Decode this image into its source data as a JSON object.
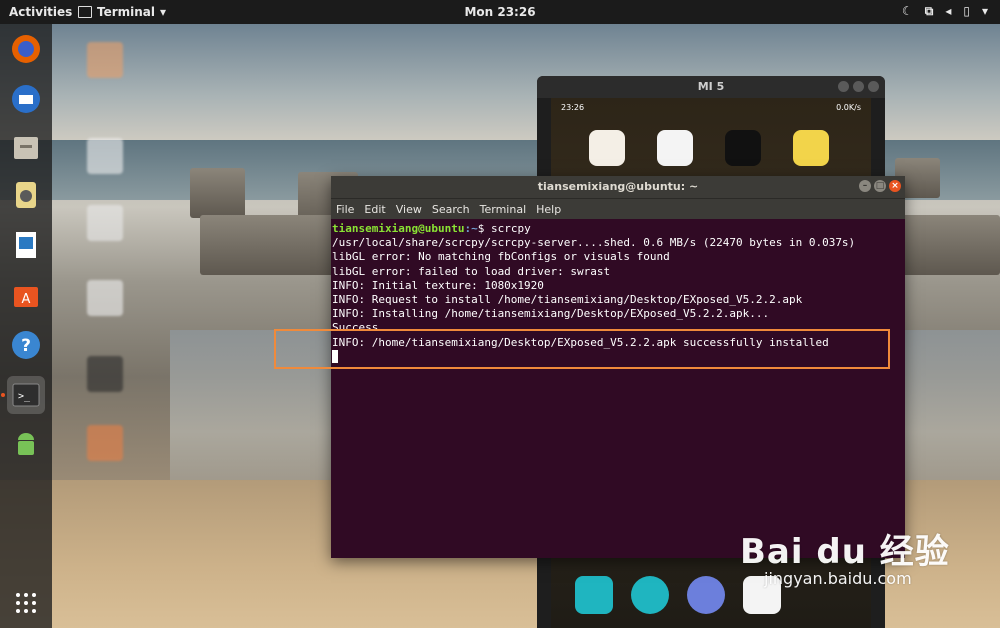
{
  "topbar": {
    "activities": "Activities",
    "app_name": "Terminal",
    "clock": "Mon 23:26"
  },
  "dock": {
    "items": [
      {
        "name": "firefox",
        "color": "#e66000"
      },
      {
        "name": "thunderbird",
        "color": "#2a6fc9"
      },
      {
        "name": "files",
        "color": "#c9c3b5"
      },
      {
        "name": "rhythmbox",
        "color": "#e8d58a"
      },
      {
        "name": "libreoffice-writer",
        "color": "#2a79c2"
      },
      {
        "name": "software-center",
        "color": "#e95420"
      },
      {
        "name": "help",
        "color": "#3a86d1"
      },
      {
        "name": "terminal",
        "color": "#2e2e2e"
      },
      {
        "name": "android-studio",
        "color": "#78c257"
      }
    ],
    "show_apps_icon": "apps-grid-icon"
  },
  "phone": {
    "title": "MI 5",
    "status_time": "23:26",
    "status_right": "0.0K/s",
    "apps": [
      {
        "name": "app-1",
        "color": "#f4efe6"
      },
      {
        "name": "baidu-icon",
        "color": "#f4f4f4"
      },
      {
        "name": "terminal-app",
        "color": "#111111"
      },
      {
        "name": "app-4",
        "color": "#f2d44a"
      }
    ],
    "dock": [
      {
        "name": "contacts",
        "color": "#1fb5c0"
      },
      {
        "name": "phone",
        "color": "#1fb5c0"
      },
      {
        "name": "browser",
        "color": "#6c7fdc"
      },
      {
        "name": "app-x",
        "color": "#f4f4f4"
      }
    ]
  },
  "terminal": {
    "title": "tiansemixiang@ubuntu: ~",
    "menu": [
      "File",
      "Edit",
      "View",
      "Search",
      "Terminal",
      "Help"
    ],
    "prompt_user": "tiansemixiang@ubuntu",
    "prompt_path": ":~",
    "prompt_symbol": "$ ",
    "command": "scrcpy",
    "lines": [
      "/usr/local/share/scrcpy/scrcpy-server....shed. 0.6 MB/s (22470 bytes in 0.037s)",
      "libGL error: No matching fbConfigs or visuals found",
      "libGL error: failed to load driver: swrast",
      "INFO: Initial texture: 1080x1920",
      "INFO: Request to install /home/tiansemixiang/Desktop/EXposed_V5.2.2.apk",
      "INFO: Installing /home/tiansemixiang/Desktop/EXposed_V5.2.2.apk...",
      "Success",
      "INFO: /home/tiansemixiang/Desktop/EXposed_V5.2.2.apk successfully installed"
    ]
  },
  "watermark": {
    "logo": "Bai du 经验",
    "url": "jingyan.baidu.com"
  }
}
